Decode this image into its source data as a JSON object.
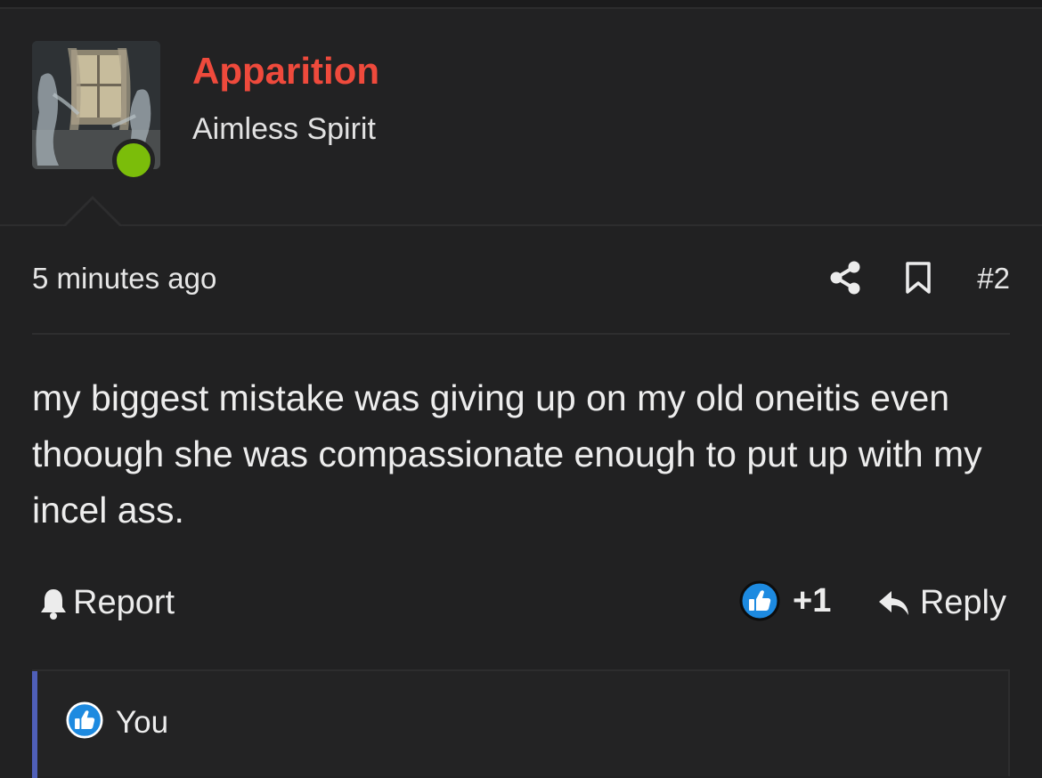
{
  "author": {
    "name": "Apparition",
    "title": "Aimless Spirit",
    "online": true,
    "name_color": "#ef4a3c",
    "online_color": "#7bbd0a"
  },
  "post": {
    "timestamp": "5 minutes ago",
    "number": "#2",
    "body": "my biggest mistake was giving up on my old oneitis even thoough she was compassionate enough to put up with my incel ass."
  },
  "actions": {
    "report_label": "Report",
    "like_count": "+1",
    "reply_label": "Reply",
    "icons": [
      "share-icon",
      "bookmark-icon",
      "bell-icon",
      "like-icon",
      "reply-icon"
    ]
  },
  "reactions": {
    "user": "You",
    "icon": "like-icon",
    "accent_color": "#4f5fb8",
    "like_color": "#1d8ae0"
  }
}
